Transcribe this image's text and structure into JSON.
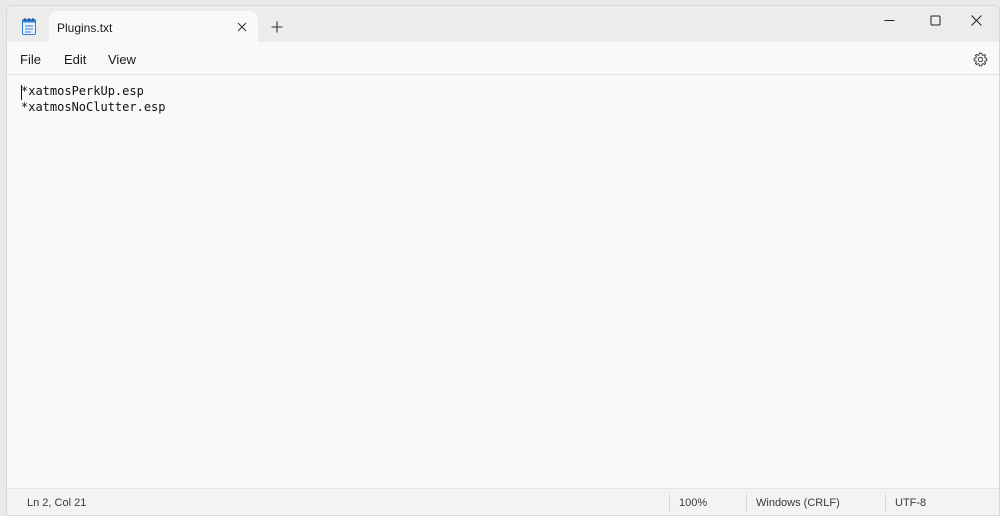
{
  "tab": {
    "title": "Plugins.txt"
  },
  "menu": {
    "file": "File",
    "edit": "Edit",
    "view": "View"
  },
  "editor": {
    "lines": [
      "*xatmosPerkUp.esp",
      "*xatmosNoClutter.esp"
    ]
  },
  "status": {
    "position": "Ln 2, Col 21",
    "zoom": "100%",
    "line_ending": "Windows (CRLF)",
    "encoding": "UTF-8"
  },
  "icons": {
    "app": "notepad-icon",
    "tab_close": "close-icon",
    "new_tab": "plus-icon",
    "minimize": "minimize-icon",
    "maximize": "maximize-icon",
    "close": "close-icon",
    "settings": "gear-icon"
  },
  "colors": {
    "accent": "#2c7fd4"
  }
}
